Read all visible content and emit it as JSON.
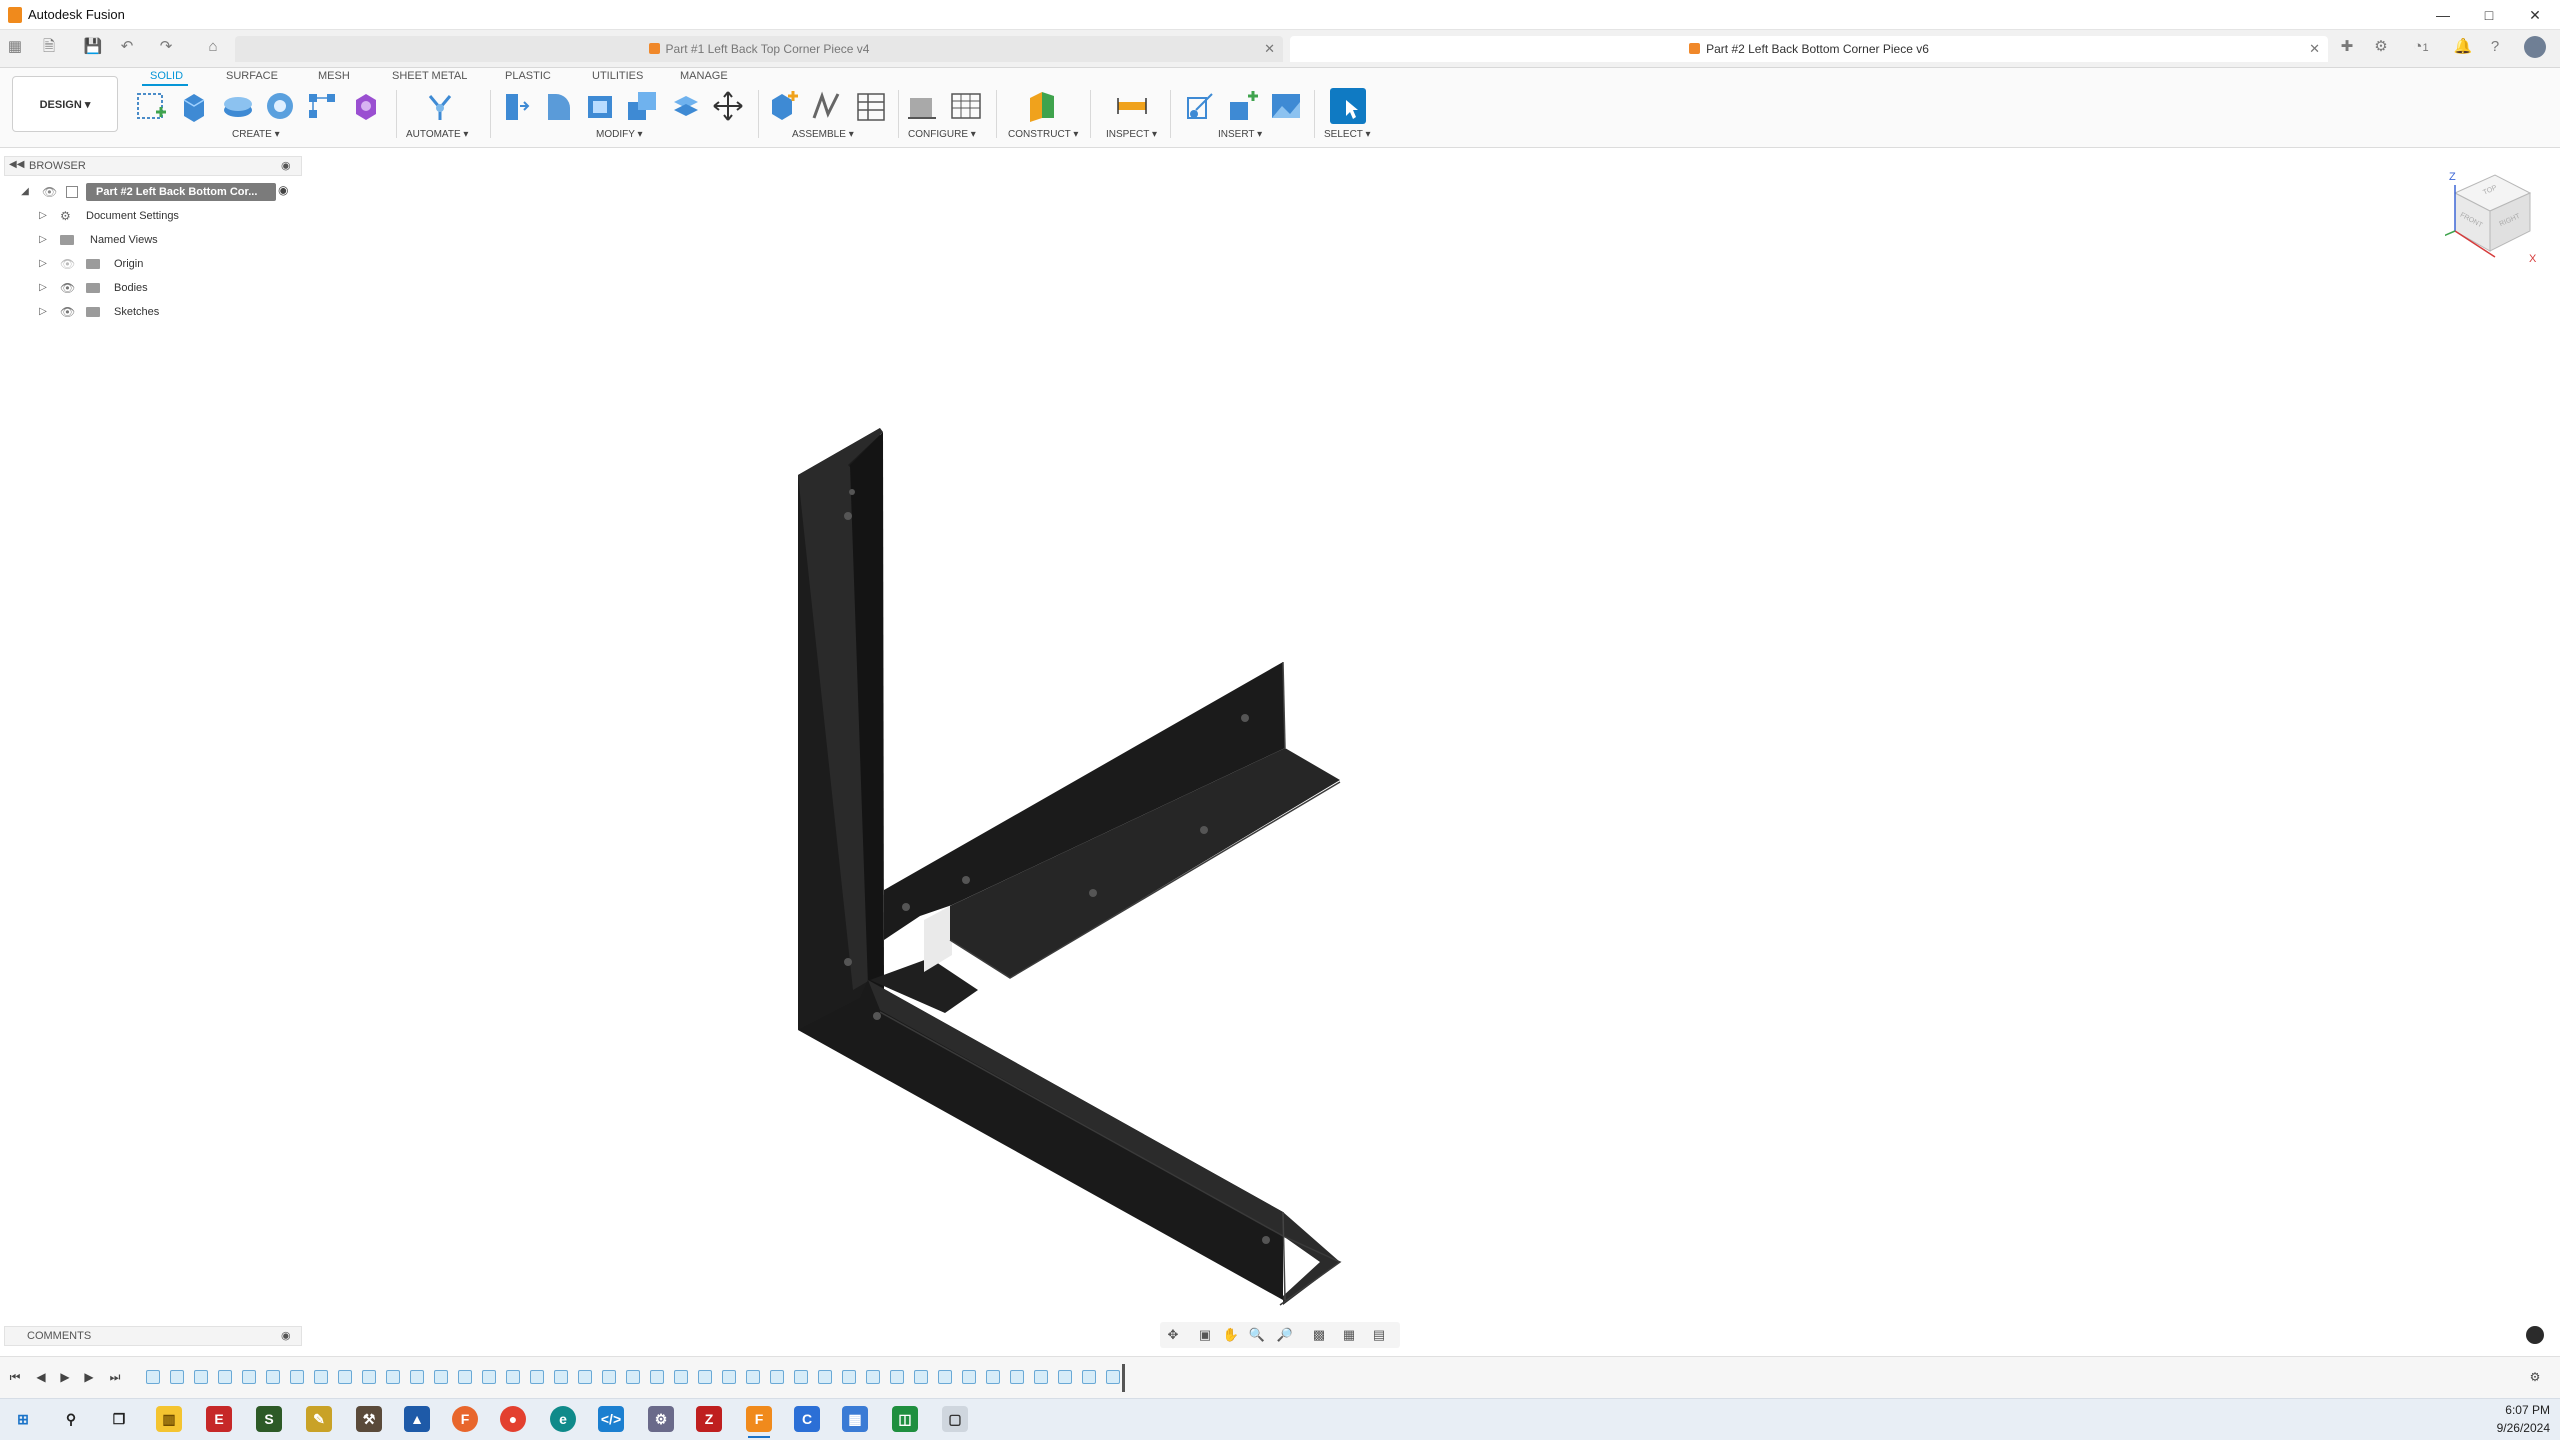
{
  "app": {
    "title": "Autodesk Fusion"
  },
  "tabs": [
    {
      "label": "Part #1 Left Back Top Corner Piece v4",
      "active": false
    },
    {
      "label": "Part #2 Left Back Bottom Corner Piece v6",
      "active": true
    }
  ],
  "header": {
    "job_status": "1"
  },
  "toolbar": {
    "workspace": "DESIGN",
    "ribbon_tabs": [
      "SOLID",
      "SURFACE",
      "MESH",
      "SHEET METAL",
      "PLASTIC",
      "UTILITIES",
      "MANAGE"
    ],
    "groups": [
      "CREATE",
      "AUTOMATE",
      "MODIFY",
      "ASSEMBLE",
      "CONFIGURE",
      "CONSTRUCT",
      "INSPECT",
      "INSERT",
      "SELECT"
    ]
  },
  "browser": {
    "title": "BROWSER",
    "root": "Part #2 Left Back Bottom Cor...",
    "items": [
      {
        "label": "Document Settings",
        "icon": "gear-icon"
      },
      {
        "label": "Named Views",
        "icon": "folder-icon"
      },
      {
        "label": "Origin",
        "icon": "folder-icon"
      },
      {
        "label": "Bodies",
        "icon": "folder-icon"
      },
      {
        "label": "Sketches",
        "icon": "folder-icon"
      }
    ]
  },
  "comments": {
    "title": "COMMENTS"
  },
  "viewcube": {
    "axis_z": "Z",
    "axis_x": "X",
    "top": "TOP",
    "front": "FRONT",
    "right": "RIGHT"
  },
  "taskbar": {
    "time": "6:07 PM",
    "date": "9/26/2024"
  },
  "colors": {
    "accent": "#0696d7",
    "model": "#1e1e1e",
    "model_edge": "#3a3a3a"
  }
}
